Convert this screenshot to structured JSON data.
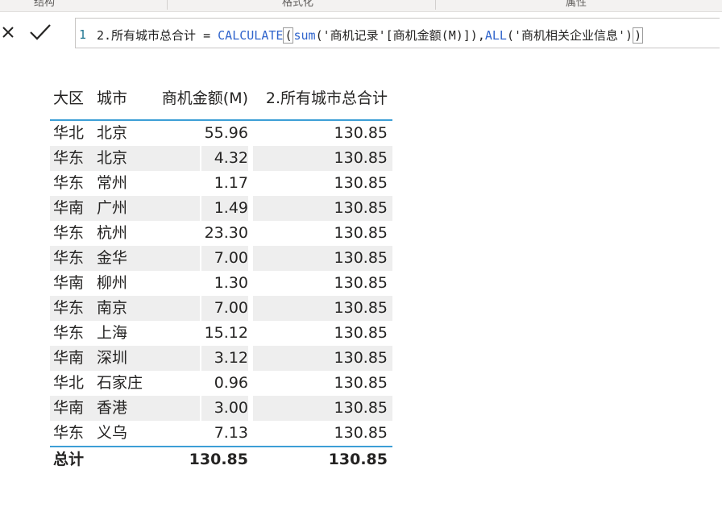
{
  "ribbon": {
    "groups": [
      "结构",
      "格式化",
      "属性"
    ]
  },
  "formula_bar": {
    "cancel_icon": "close-icon",
    "commit_icon": "check-icon",
    "line_number": "1",
    "measure_name": "2.所有城市总合计",
    "operator": " = ",
    "fn_calculate": "CALCULATE",
    "open_paren": "(",
    "fn_sum": "sum",
    "sum_arg": "('商机记录'[商机金额(M)]),",
    "fn_all": "ALL",
    "all_arg": "('商机相关企业信息')",
    "close_paren": ")"
  },
  "table": {
    "headers": [
      "大区",
      "城市",
      "商机金额(M)",
      "2.所有城市总合计"
    ],
    "rows": [
      [
        "华北",
        "北京",
        "55.96",
        "130.85"
      ],
      [
        "华东",
        "北京",
        "4.32",
        "130.85"
      ],
      [
        "华东",
        "常州",
        "1.17",
        "130.85"
      ],
      [
        "华南",
        "广州",
        "1.49",
        "130.85"
      ],
      [
        "华东",
        "杭州",
        "23.30",
        "130.85"
      ],
      [
        "华东",
        "金华",
        "7.00",
        "130.85"
      ],
      [
        "华南",
        "柳州",
        "1.30",
        "130.85"
      ],
      [
        "华东",
        "南京",
        "7.00",
        "130.85"
      ],
      [
        "华东",
        "上海",
        "15.12",
        "130.85"
      ],
      [
        "华南",
        "深圳",
        "3.12",
        "130.85"
      ],
      [
        "华北",
        "石家庄",
        "0.96",
        "130.85"
      ],
      [
        "华南",
        "香港",
        "3.00",
        "130.85"
      ],
      [
        "华东",
        "义乌",
        "7.13",
        "130.85"
      ]
    ],
    "footer": {
      "label": "总计",
      "amount": "130.85",
      "total": "130.85"
    }
  },
  "colors": {
    "accent_line": "#3d9fd6",
    "function_blue": "#3165cc",
    "stripe": "#eeeeee"
  }
}
